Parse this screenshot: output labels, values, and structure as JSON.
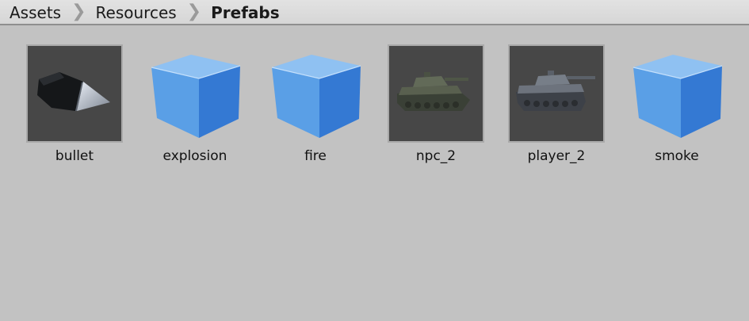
{
  "breadcrumb": {
    "items": [
      {
        "label": "Assets"
      },
      {
        "label": "Resources"
      },
      {
        "label": "Prefabs"
      }
    ],
    "separator_icon": "chevron-right-icon"
  },
  "assets": [
    {
      "name": "bullet",
      "thumbnail": "bullet-preview"
    },
    {
      "name": "explosion",
      "thumbnail": "prefab-cube-icon"
    },
    {
      "name": "fire",
      "thumbnail": "prefab-cube-icon"
    },
    {
      "name": "npc_2",
      "thumbnail": "tank-preview"
    },
    {
      "name": "player_2",
      "thumbnail": "tank-preview"
    },
    {
      "name": "smoke",
      "thumbnail": "prefab-cube-icon"
    }
  ],
  "colors": {
    "background": "#c2c2c2",
    "cube_light": "#9cc9f5",
    "cube_mid": "#4f97e3",
    "cube_dark": "#2a6cc7",
    "preview_bg": "#474747"
  }
}
